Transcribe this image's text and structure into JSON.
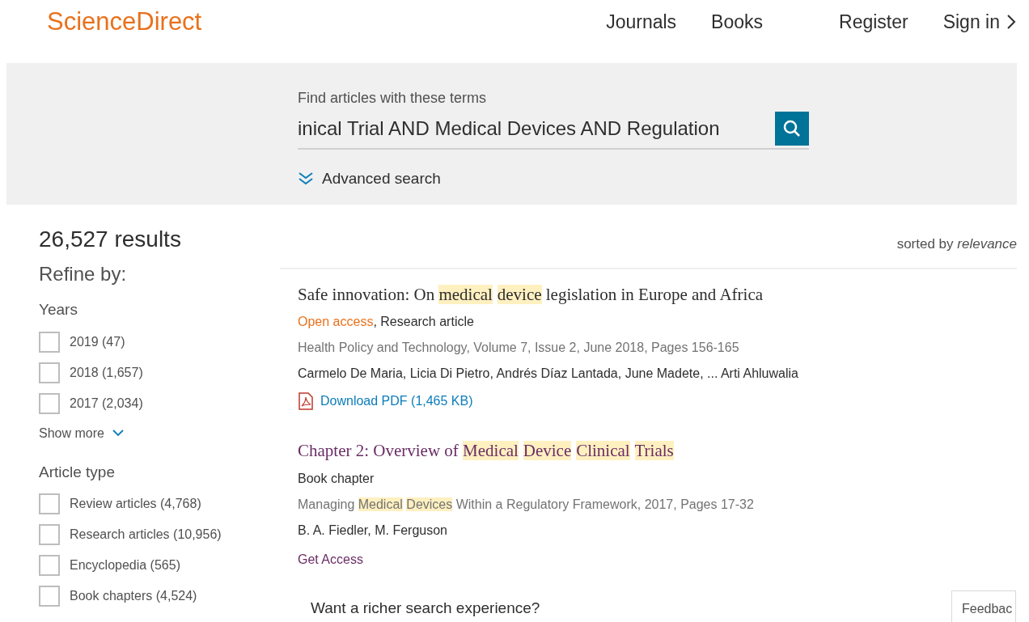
{
  "header": {
    "logo": "ScienceDirect",
    "nav": [
      "Journals",
      "Books"
    ],
    "register": "Register",
    "sign_in": "Sign in"
  },
  "search": {
    "label": "Find articles with these terms",
    "value": "inical Trial AND Medical Devices AND Regulation",
    "advanced": "Advanced search"
  },
  "results_count": "26,527 results",
  "sort": "sorted by *relevance*",
  "refine": {
    "title": "Refine by:",
    "groups": [
      {
        "title": "Years",
        "options": [
          {
            "label": "2019 (47)",
            "checked": false
          },
          {
            "label": "2018 (1,657)",
            "checked": false
          },
          {
            "label": "2017 (2,034)",
            "checked": false
          }
        ],
        "show_more": "Show more"
      },
      {
        "title": "Article type",
        "options": [
          {
            "label": "Review articles (4,768)",
            "checked": false
          },
          {
            "label": "Research articles (10,956)",
            "checked": false
          },
          {
            "label": "Encyclopedia (565)",
            "checked": false
          },
          {
            "label": "Book chapters (4,524)",
            "checked": false
          }
        ]
      }
    ]
  },
  "results": [
    {
      "title": [
        {
          "text": "Safe innovation: On ",
          "highlight": false
        },
        {
          "text": "medical",
          "highlight": true
        },
        {
          "text": "device",
          "highlight": true
        },
        {
          "text": " legislation in Europe and Africa",
          "highlight": false
        }
      ],
      "visited": false,
      "open_access": "Open access",
      "type": ", Research article",
      "source": [
        {
          "text": "Health Policy and Technology, Volume 7, Issue 2, June 2018, Pages 156-165",
          "highlight": false
        }
      ],
      "authors": "Carmelo De Maria, Licia Di Pietro, Andrés Díaz Lantada, June Madete, ... Arti Ahluwalia",
      "link": "Download PDF (1,465 KB)",
      "kind": "pdf"
    },
    {
      "title": [
        {
          "text": "Chapter 2: Overview of ",
          "highlight": false
        },
        {
          "text": "Medical",
          "highlight": true
        },
        {
          "text": "Device",
          "highlight": true
        },
        {
          "text": "Clinical",
          "highlight": true
        },
        {
          "text": "Trials",
          "highlight": true
        }
      ],
      "visited": true,
      "type": "Book chapter",
      "source": [
        {
          "text": "Managing ",
          "highlight": false
        },
        {
          "text": "Medical",
          "highlight": true
        },
        {
          "text": "Devices",
          "highlight": true
        },
        {
          "text": " Within a Regulatory Framework, 2017, Pages 17-32",
          "highlight": false
        }
      ],
      "authors": "B. A. Fiedler, M. Ferguson",
      "link": "Get Access",
      "kind": "access"
    }
  ],
  "promo": "Want a richer search experience?",
  "feedback": "Feedbac"
}
